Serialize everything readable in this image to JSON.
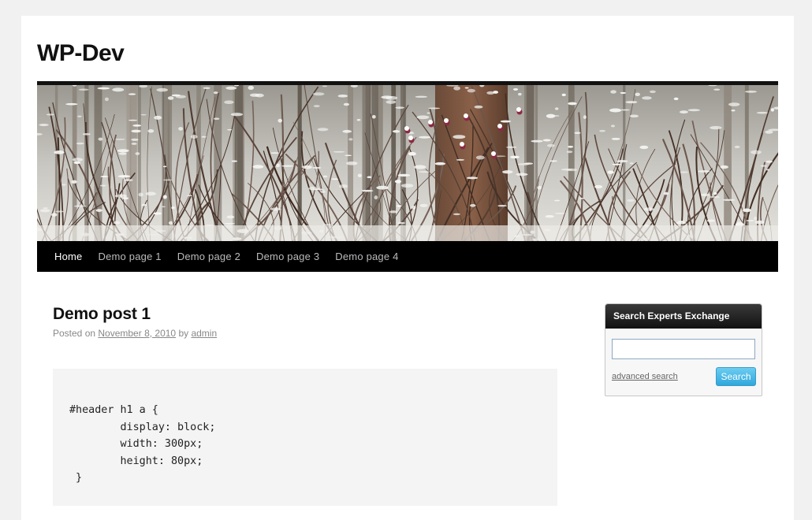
{
  "site": {
    "title": "WP-Dev"
  },
  "nav": {
    "items": [
      {
        "label": "Home",
        "current": true
      },
      {
        "label": "Demo page 1"
      },
      {
        "label": "Demo page 2"
      },
      {
        "label": "Demo page 3"
      },
      {
        "label": "Demo page 4"
      }
    ]
  },
  "post": {
    "title": "Demo post 1",
    "meta_prefix": "Posted on ",
    "date": "November 8, 2010",
    "meta_by": " by ",
    "author": "admin",
    "code": "#header h1 a {\n        display: block;\n        width: 300px;\n        height: 80px;\n }"
  },
  "widget": {
    "title": "Search Experts Exchange",
    "input_value": "",
    "advanced_link": "advanced search",
    "button_label": "Search"
  },
  "colors": {
    "background": "#f1f1f1",
    "nav_bar": "#000000",
    "search_button": "#2fa7dc",
    "code_background": "#f4f4f4"
  },
  "header_image": {
    "subject": "snowy winter forest with bare branches and red berries"
  }
}
